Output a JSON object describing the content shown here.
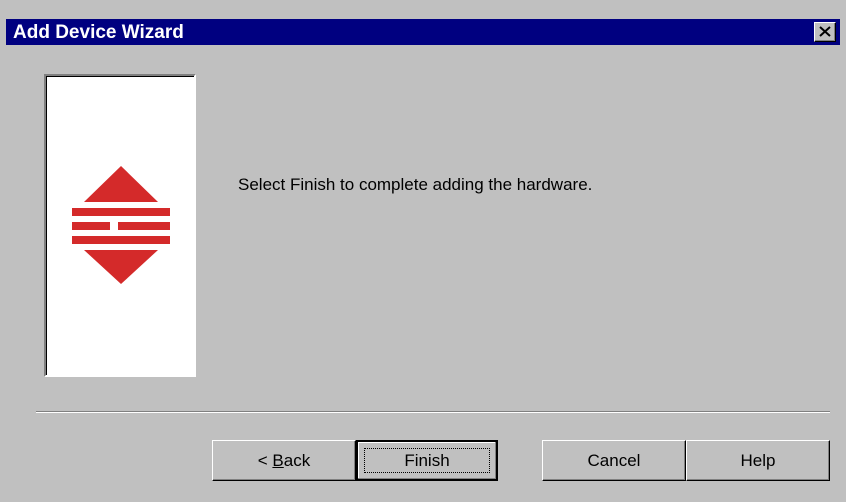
{
  "window": {
    "title": "Add Device Wizard"
  },
  "icons": {
    "close": "close-icon",
    "logo": "wizard-logo-icon"
  },
  "colors": {
    "titlebar": "#000080",
    "face": "#c0c0c0",
    "logo_red": "#d42a2a"
  },
  "content": {
    "message": "Select Finish to complete adding the hardware."
  },
  "buttons": {
    "back_prefix": "< ",
    "back_mnemonic": "B",
    "back_rest": "ack",
    "finish": "Finish",
    "cancel": "Cancel",
    "help": "Help"
  }
}
